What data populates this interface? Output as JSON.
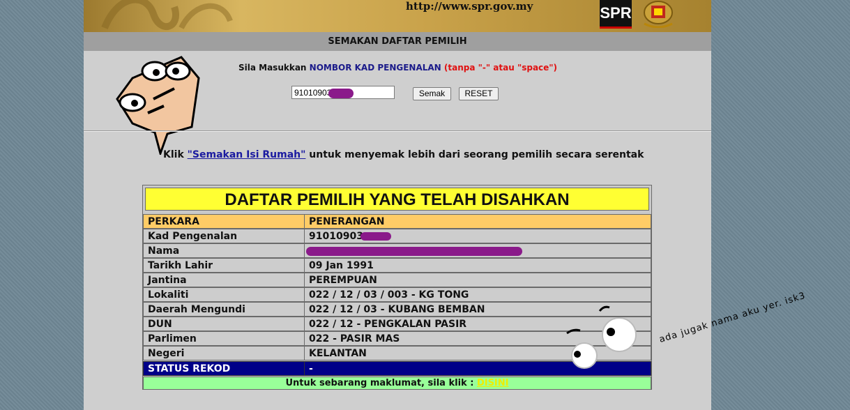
{
  "banner": {
    "url": "http://www.spr.gov.my",
    "logo_text": "SPR"
  },
  "title_bar": "SEMAKAN DAFTAR PEMILIH",
  "prompt": {
    "prefix": "Sila Masukkan ",
    "highlight": "NOMBOR KAD PENGENALAN",
    "note": "(tanpa \"-\" atau \"space\")"
  },
  "search": {
    "value": "91010903",
    "semak_label": "Semak",
    "reset_label": "RESET"
  },
  "klik": {
    "prefix": "Klik ",
    "link": "\"Semakan Isi Rumah\"",
    "suffix": " untuk menyemak lebih dari seorang pemilih secara serentak"
  },
  "table": {
    "title": "DAFTAR PEMILIH YANG TELAH DISAHKAN",
    "header": [
      "PERKARA",
      "PENERANGAN"
    ],
    "rows": [
      {
        "label": "Kad Pengenalan",
        "value": "91010903"
      },
      {
        "label": "Nama",
        "value": ""
      },
      {
        "label": "Tarikh Lahir",
        "value": "09 Jan 1991"
      },
      {
        "label": "Jantina",
        "value": "PEREMPUAN"
      },
      {
        "label": "Lokaliti",
        "value": "022 / 12 / 03 / 003 - KG TONG"
      },
      {
        "label": "Daerah Mengundi",
        "value": "022 / 12 / 03 - KUBANG BEMBAN"
      },
      {
        "label": "DUN",
        "value": "022 / 12 - PENGKALAN PASIR"
      },
      {
        "label": "Parlimen",
        "value": "022 - PASIR MAS"
      },
      {
        "label": "Negeri",
        "value": "KELANTAN"
      }
    ],
    "status": {
      "label": "STATUS REKOD",
      "value": "-"
    },
    "footer_prefix": "Untuk sebarang maklumat, sila klik : ",
    "footer_link": "DISINI"
  },
  "annotation": "ada jugak nama aku yer. isk3",
  "colors": {
    "title_yellow": "#ffff33",
    "header_orange": "#ffcc66",
    "status_navy": "#000088",
    "footer_green": "#99ff99",
    "redaction_purple": "#8a1a8a"
  }
}
